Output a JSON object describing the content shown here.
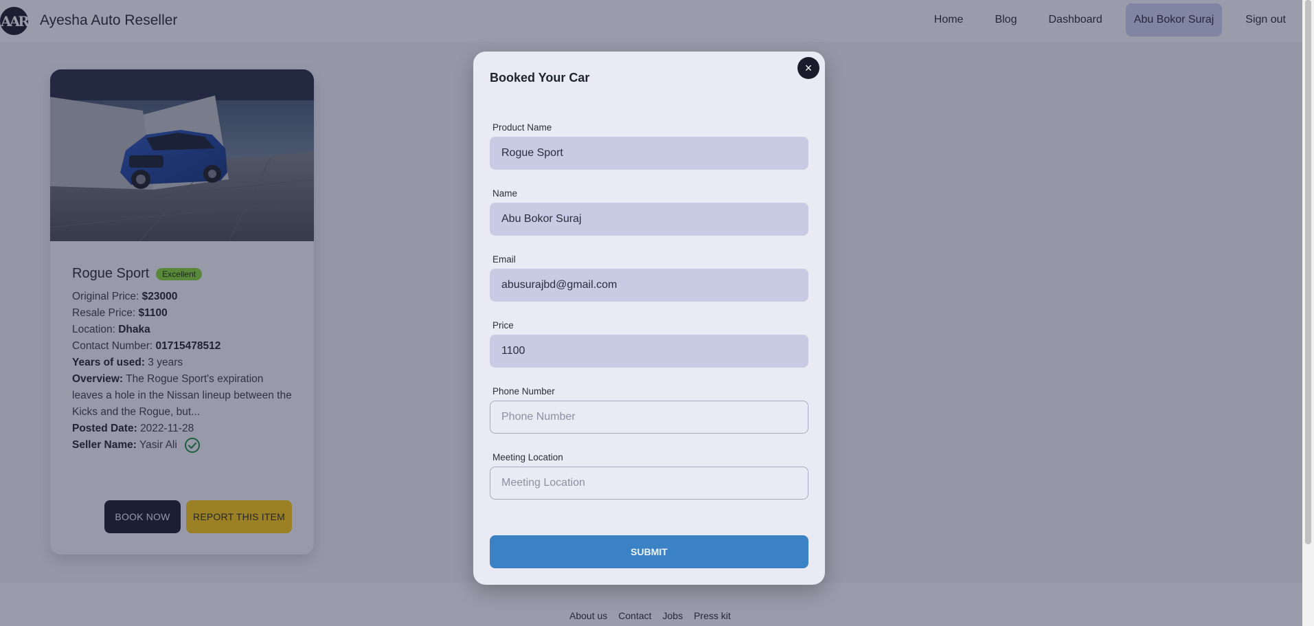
{
  "nav": {
    "logo_text": "AAR",
    "brand": "Ayesha Auto Reseller",
    "links": [
      "Home",
      "Blog",
      "Dashboard",
      "Abu Bokor Suraj",
      "Sign out"
    ]
  },
  "card": {
    "title": "Rogue Sport",
    "badge": "Excellent",
    "original_price_label": "Original Price:",
    "original_price": "$23000",
    "resale_price_label": "Resale Price:",
    "resale_price": "$1100",
    "location_label": "Location:",
    "location": "Dhaka",
    "contact_label": "Contact Number:",
    "contact": "01715478512",
    "years_label": "Years of used:",
    "years": "3 years",
    "overview_label": "Overview:",
    "overview": "The Rogue Sport's expiration leaves a hole in the Nissan lineup between the Kicks and the Rogue, but...",
    "posted_label": "Posted Date:",
    "posted": "2022-11-28",
    "seller_label": "Seller Name:",
    "seller": "Yasir Ali",
    "book_label": "BOOK NOW",
    "report_label": "REPORT THIS ITEM"
  },
  "modal": {
    "title": "Booked Your Car",
    "close_icon": "×",
    "fields": [
      {
        "label": "Product Name",
        "value": "Rogue Sport",
        "placeholder": ""
      },
      {
        "label": "Name",
        "value": "Abu Bokor Suraj",
        "placeholder": ""
      },
      {
        "label": "Email",
        "value": "abusurajbd@gmail.com",
        "placeholder": ""
      },
      {
        "label": "Price",
        "value": "1100",
        "placeholder": ""
      },
      {
        "label": "Phone Number",
        "value": "",
        "placeholder": "Phone Number"
      },
      {
        "label": "Meeting Location",
        "value": "",
        "placeholder": "Meeting Location"
      }
    ],
    "submit_label": "SUBMIT"
  },
  "footer": {
    "links": [
      "About us",
      "Contact",
      "Jobs",
      "Press kit"
    ]
  },
  "colors": {
    "badge": "#84d23a",
    "primary_dark": "#1a1c2c",
    "report": "#f5c518",
    "submit": "#3b82c4",
    "verified": "#1f8a4c"
  }
}
